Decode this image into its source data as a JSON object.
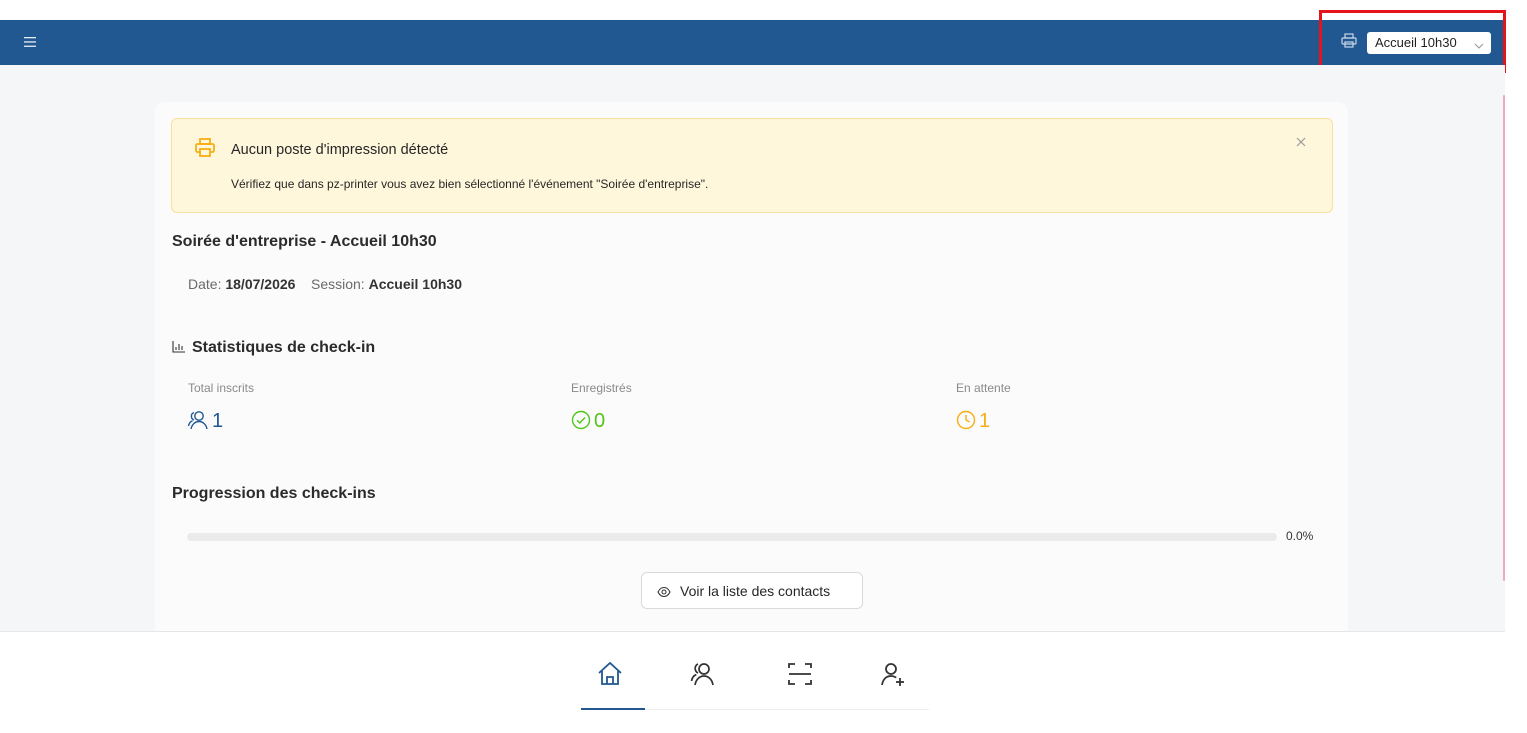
{
  "header": {
    "menu_icon": "hamburger-menu-icon",
    "printer_icon": "printer-icon",
    "session_select": {
      "value": "Accueil 10h30",
      "icon": "chevron-down-icon"
    }
  },
  "alert": {
    "icon": "printer-icon",
    "title": "Aucun poste d'impression détecté",
    "description": "Vérifiez que dans pz-printer vous avez bien sélectionné l'événement \"Soirée d'entreprise\".",
    "close_icon": "close-icon"
  },
  "event": {
    "title": "Soirée d'entreprise - Accueil 10h30",
    "date_label": "Date:",
    "date_value": "18/07/2026",
    "session_label": "Session:",
    "session_value": "Accueil 10h30"
  },
  "stats": {
    "title": "Statistiques de check-in",
    "icon": "bar-chart-icon",
    "items": [
      {
        "label": "Total inscrits",
        "value": "1",
        "icon": "users-icon",
        "color": "#215891"
      },
      {
        "label": "Enregistrés",
        "value": "0",
        "icon": "check-circle-icon",
        "color": "#52c41a"
      },
      {
        "label": "En attente",
        "value": "1",
        "icon": "clock-icon",
        "color": "#faad14"
      }
    ]
  },
  "progress": {
    "title": "Progression des check-ins",
    "percent": 0,
    "label": "0.0%"
  },
  "contacts_button": {
    "label": "Voir la liste des contacts",
    "icon": "eye-icon"
  },
  "bottom_nav": {
    "items": [
      {
        "icon": "home-icon",
        "active": true
      },
      {
        "icon": "users-icon",
        "active": false
      },
      {
        "icon": "scan-icon",
        "active": false
      },
      {
        "icon": "add-user-icon",
        "active": false
      }
    ]
  },
  "colors": {
    "primary": "#215891",
    "alert_bg": "#fff7dc",
    "alert_icon": "#faad14",
    "success": "#52c41a",
    "warning": "#faad14",
    "highlight": "#e5141b"
  }
}
